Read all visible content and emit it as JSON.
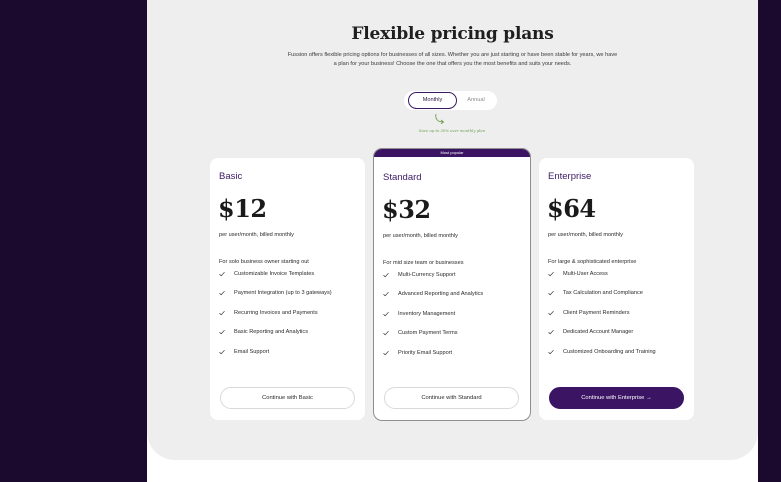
{
  "header": {
    "title": "Flexible pricing plans",
    "subtitle": "Fussion offers flexible pricing options for businesses of all sizes. Whether you are just starting or have been stable for years, we have a plan for your business! Choose the one that offers you the most benefits and suits your needs."
  },
  "billing_toggle": {
    "monthly": "Monthly",
    "annual": "Annual",
    "selected": "Monthly",
    "promo": "Save up to 30% over monthly plan"
  },
  "plans": [
    {
      "name": "Basic",
      "price": "$12",
      "period": "per user/month, billed monthly",
      "target": "For solo business owner starting out",
      "features": [
        "Customizable Invoice Templates",
        "Payment Integration (up to 3 gateways)",
        "Recurring Invoices and Payments",
        "Basic Reporting and Analytics",
        "Email Support"
      ],
      "cta": "Continue with Basic"
    },
    {
      "badge": "Most popular",
      "name": "Standard",
      "price": "$32",
      "period": "per user/month, billed monthly",
      "target": "For mid size team or businesses",
      "features": [
        "Multi-Currency Support",
        "Advanced Reporting and Analytics",
        "Inventory Management",
        "Custom Payment Terms",
        "Priority Email Support"
      ],
      "cta": "Continue with Standard"
    },
    {
      "name": "Enterprise",
      "price": "$64",
      "period": "per user/month, billed monthly",
      "target": "For large & sophisticated enterprise",
      "features": [
        "Multi-User Access",
        "Tax Calculation and Compliance",
        "Client Payment Reminders",
        "Dedicated Account Manager",
        "Customized Onboarding and Training"
      ],
      "cta": "Continue with Enterprise →"
    }
  ],
  "colors": {
    "accent": "#3b1563",
    "sidebar": "#1b0a2e",
    "promo": "#6aa04c",
    "panel": "#eeeeee"
  }
}
